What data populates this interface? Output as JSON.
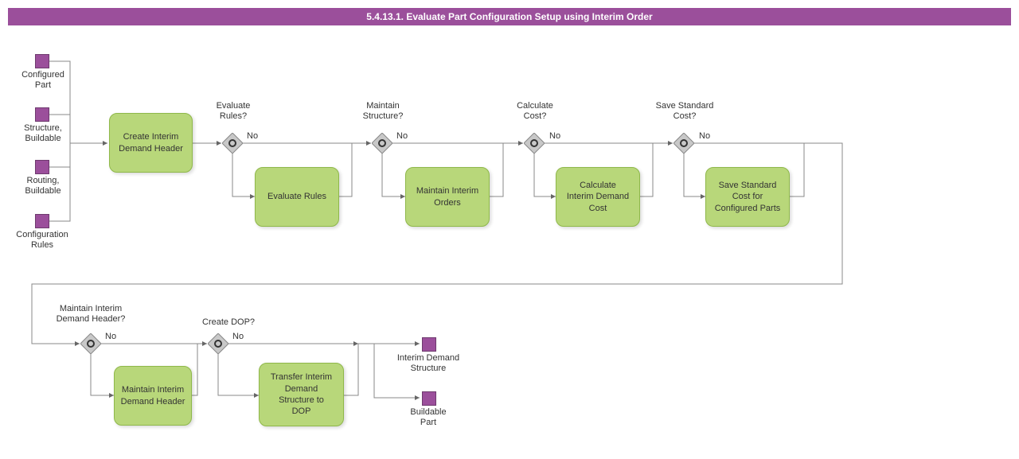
{
  "title": "5.4.13.1. Evaluate Part Configuration Setup using Interim Order",
  "inputs": {
    "configured_part": "Configured\nPart",
    "structure_buildable": "Structure,\nBuildable",
    "routing_buildable": "Routing,\nBuildable",
    "configuration_rules": "Configuration\nRules"
  },
  "tasks": {
    "create_interim_demand_header": "Create Interim\nDemand Header",
    "evaluate_rules": "Evaluate Rules",
    "maintain_interim_orders": "Maintain Interim\nOrders",
    "calculate_interim_demand_cost": "Calculate\nInterim Demand\nCost",
    "save_standard_cost": "Save Standard\nCost for\nConfigured Parts",
    "maintain_interim_demand_header": "Maintain Interim\nDemand Header",
    "transfer_to_dop": "Transfer Interim\nDemand\nStructure to\nDOP"
  },
  "gateways": {
    "evaluate_rules_q": "Evaluate\nRules?",
    "maintain_structure_q": "Maintain\nStructure?",
    "calculate_cost_q": "Calculate\nCost?",
    "save_standard_cost_q": "Save Standard\nCost?",
    "maintain_header_q": "Maintain Interim\nDemand Header?",
    "create_dop_q": "Create DOP?"
  },
  "outputs": {
    "interim_demand_structure": "Interim Demand\nStructure",
    "buildable_part": "Buildable\nPart"
  },
  "edge_no": "No"
}
